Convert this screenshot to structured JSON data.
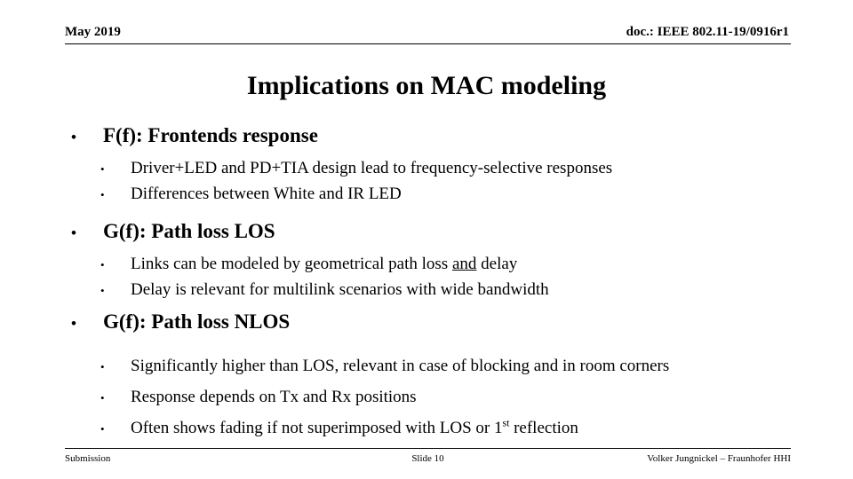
{
  "header": {
    "date": "May 2019",
    "doc_ref": "doc.: IEEE 802.11-19/0916r1"
  },
  "title": "Implications on MAC modeling",
  "content": {
    "bullets": [
      {
        "level": 1,
        "marker": "•",
        "text": "F(f): Frontends response"
      },
      {
        "level": 2,
        "marker": "•",
        "text": "Driver+LED and PD+TIA design lead to frequency-selective responses"
      },
      {
        "level": 2,
        "marker": "•",
        "text": "Differences between White and IR LED"
      },
      {
        "level": 1,
        "marker": "•",
        "text": "G(f): Path loss LOS"
      },
      {
        "level": 2,
        "marker": "•",
        "text_before": "Links can be modeled by geometrical path loss ",
        "text_underlined": "and",
        "text_after": " delay",
        "text": "Links can be modeled by geometrical path loss and delay"
      },
      {
        "level": 2,
        "marker": "•",
        "text": "Delay is relevant for multilink scenarios with wide bandwidth"
      },
      {
        "level": 1,
        "marker": "•",
        "text": "G(f): Path loss NLOS"
      },
      {
        "level": 2,
        "marker": "•",
        "text": "Significantly higher than LOS, relevant in case of blocking and in room corners"
      },
      {
        "level": 2,
        "marker": "•",
        "text": "Response depends on Tx and Rx positions"
      },
      {
        "level": 2,
        "marker": "•",
        "text_before": "Often shows fading if not superimposed with LOS or 1",
        "text_superscript": "st",
        "text_after": " reflection",
        "text": "Often shows fading if not superimposed with LOS or 1st reflection"
      }
    ]
  },
  "footer": {
    "left": "Submission",
    "center": "Slide 10",
    "right": "Volker Jungnickel – Fraunhofer HHI"
  },
  "colors": {
    "background": "#ffffff",
    "text": "#000000",
    "rule": "#000000"
  }
}
